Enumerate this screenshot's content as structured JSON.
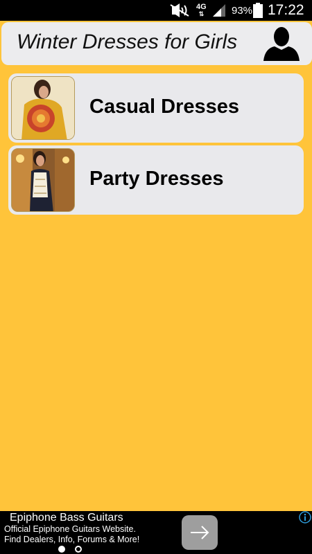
{
  "status_bar": {
    "network_type": "4G",
    "battery_percent": "93%",
    "time": "17:22",
    "icons": [
      "mute-icon",
      "network-4g-icon",
      "signal-icon",
      "battery-icon"
    ]
  },
  "header": {
    "title": "Winter Dresses for Girls",
    "profile_icon": "person-silhouette-icon"
  },
  "list": {
    "items": [
      {
        "label": "Casual Dresses",
        "thumbnail": "casual-dress-thumbnail"
      },
      {
        "label": "Party Dresses",
        "thumbnail": "party-dress-thumbnail"
      }
    ]
  },
  "ad": {
    "title": "Epiphone Bass Guitars",
    "line1": "Official Epiphone Guitars Website.",
    "line2": "Find Dealers, Info, Forums & More!",
    "button_icon": "arrow-right-icon",
    "info_icon": "info-icon",
    "page_indicator": {
      "count": 2,
      "active": 1
    }
  },
  "colors": {
    "background": "#FFC43A",
    "card": "#E9E9EC",
    "status_bar": "#000000",
    "ad_background": "#000000",
    "ad_button": "#9E9E9E",
    "info_icon": "#2D9CDB"
  }
}
